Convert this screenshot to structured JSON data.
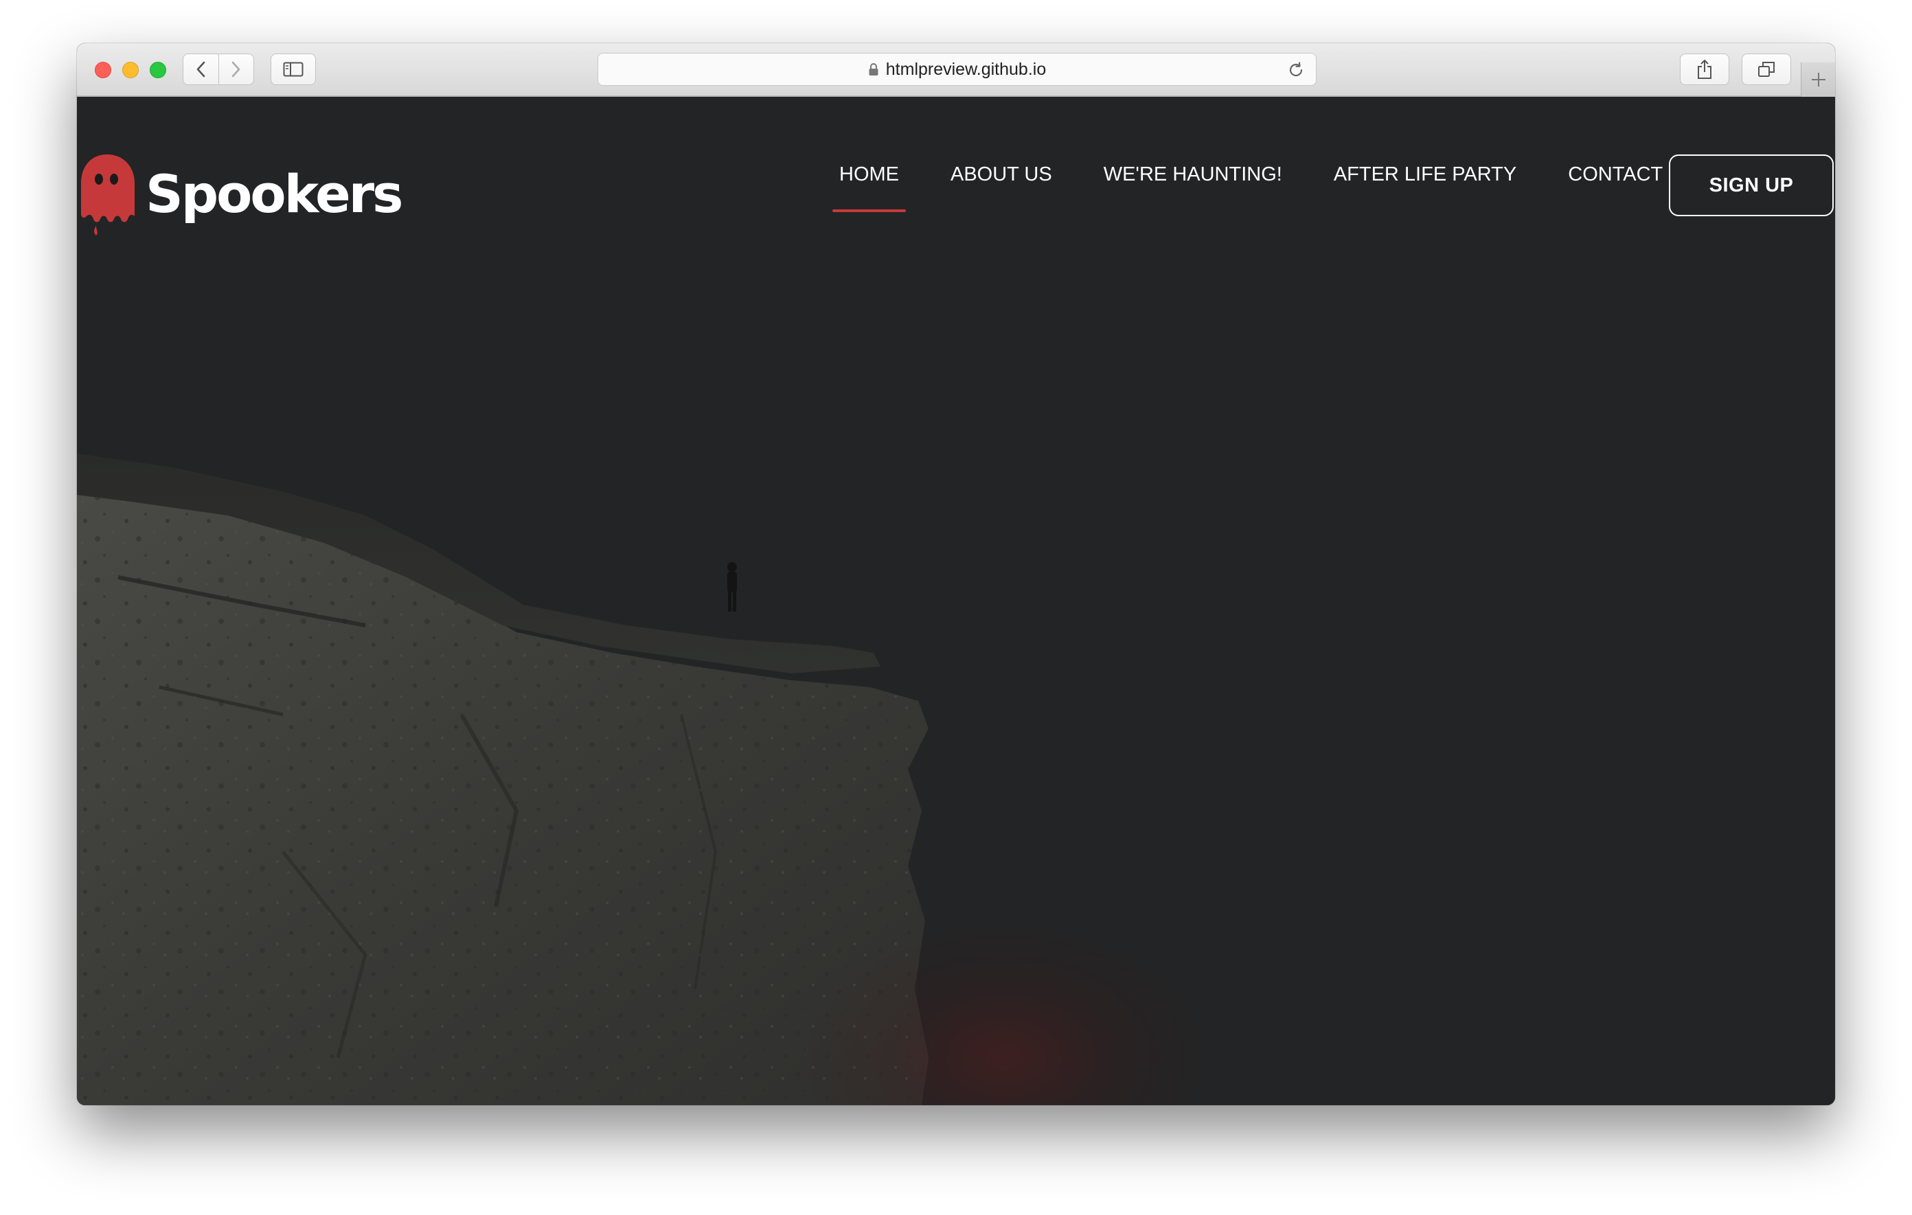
{
  "browser": {
    "url": "htmlpreview.github.io"
  },
  "site": {
    "brand": "Spookers",
    "accent_color": "#c6393a",
    "nav": [
      {
        "label": "HOME",
        "active": true
      },
      {
        "label": "ABOUT US",
        "active": false
      },
      {
        "label": "WE'RE HAUNTING!",
        "active": false
      },
      {
        "label": "AFTER LIFE PARTY",
        "active": false
      },
      {
        "label": "CONTACT",
        "active": false
      }
    ],
    "signup_label": "SIGN UP"
  },
  "icons": {
    "logo": "ghost-icon",
    "lock": "lock-icon",
    "reload": "reload-icon",
    "back": "chevron-left-icon",
    "forward": "chevron-right-icon",
    "sidebar": "sidebar-icon",
    "share": "share-icon",
    "tabs": "tabs-overview-icon",
    "new_tab": "plus-icon"
  }
}
